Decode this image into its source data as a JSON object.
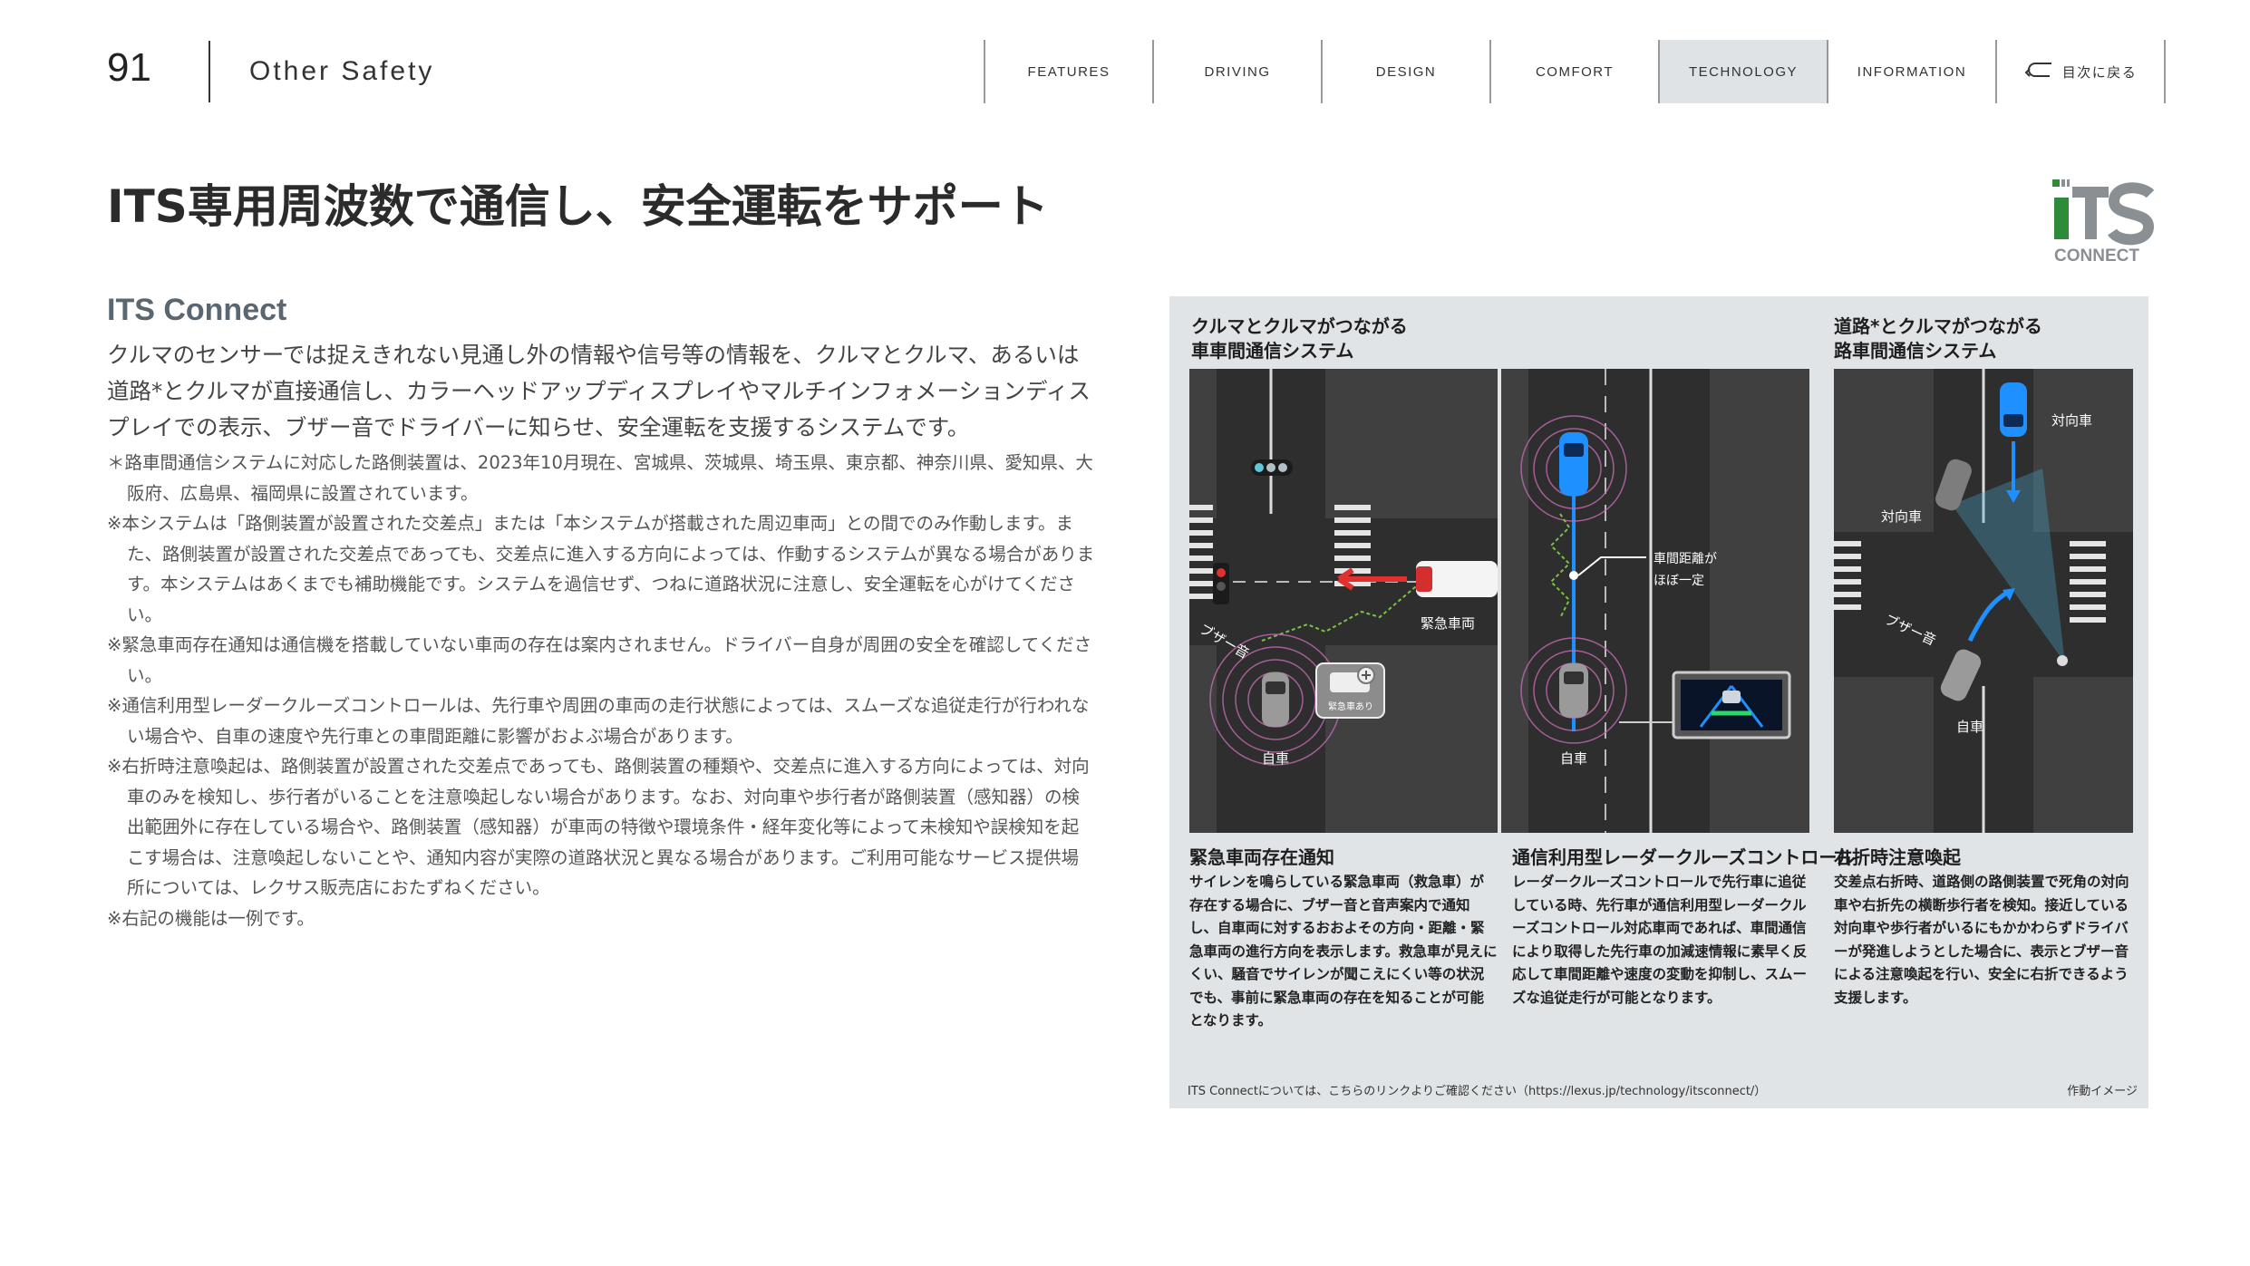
{
  "header": {
    "page_number": "91",
    "section_title": "Other Safety",
    "nav": [
      "FEATURES",
      "DRIVING",
      "DESIGN",
      "COMFORT",
      "TECHNOLOGY",
      "INFORMATION"
    ],
    "active_nav": "TECHNOLOGY",
    "back_label": "目次に戻る"
  },
  "main": {
    "heading": "ITS専用周波数で通信し、安全運転をサポート",
    "logo": {
      "text": "iTS",
      "sub": "CONNECT",
      "colors": {
        "green": "#2e8b3a",
        "gray": "#8a8f94"
      }
    }
  },
  "left": {
    "sub_heading": "ITS Connect",
    "intro": "クルマのセンサーでは捉えきれない見通し外の情報や信号等の情報を、クルマとクルマ、あるいは道路*とクルマが直接通信し、カラーヘッドアップディスプレイやマルチインフォメーションディスプレイでの表示、ブザー音でドライバーに知らせ、安全運転を支援するシステムです。",
    "notes": [
      "＊路車間通信システムに対応した路側装置は、2023年10月現在、宮城県、茨城県、埼玉県、東京都、神奈川県、愛知県、大阪府、広島県、福岡県に設置されています。",
      "※本システムは「路側装置が設置された交差点」または「本システムが搭載された周辺車両」との間でのみ作動します。また、路側装置が設置された交差点であっても、交差点に進入する方向によっては、作動するシステムが異なる場合があります。本システムはあくまでも補助機能です。システムを過信せず、つねに道路状況に注意し、安全運転を心がけてください。",
      "※緊急車両存在通知は通信機を搭載していない車両の存在は案内されません。ドライバー自身が周囲の安全を確認してください。",
      "※通信利用型レーダークルーズコントロールは、先行車や周囲の車両の走行状態によっては、スムーズな追従走行が行われない場合や、自車の速度や先行車との車間距離に影響がおよぶ場合があります。",
      "※右折時注意喚起は、路側装置が設置された交差点であっても、路側装置の種類や、交差点に進入する方向によっては、対向車のみを検知し、歩行者がいることを注意喚起しない場合があります。なお、対向車や歩行者が路側装置（感知器）の検出範囲外に存在している場合や、路側装置（感知器）が車両の特徴や環境条件・経年変化等によって未検知や誤検知を起こす場合は、注意喚起しないことや、通知内容が実際の道路状況と異なる場合があります。ご利用可能なサービス提供場所については、レクサス販売店におたずねください。",
      "※右記の機能は一例です。"
    ]
  },
  "panel": {
    "group1_title": "クルマとクルマがつながる\n車車間通信システム",
    "group2_title": "道路*とクルマがつながる\n路車間通信システム",
    "scenes": {
      "emergency": {
        "buzzer": "ブザー音",
        "ego": "自車",
        "emergency_vehicle": "緊急車両",
        "icon_label": "緊急車あり"
      },
      "cruise": {
        "gap_label_1": "車間距離が",
        "gap_label_2": "ほぼ一定",
        "ego": "自車"
      },
      "rightturn": {
        "oncoming_1": "対向車",
        "oncoming_2": "対向車",
        "buzzer": "ブザー音",
        "ego": "自車"
      }
    },
    "features": [
      {
        "title": "緊急車両存在通知",
        "body": "サイレンを鳴らしている緊急車両（救急車）が存在する場合に、ブザー音と音声案内で通知し、自車両に対するおおよその方向・距離・緊急車両の進行方向を表示します。救急車が見えにくい、騒音でサイレンが聞こえにくい等の状況でも、事前に緊急車両の存在を知ることが可能となります。"
      },
      {
        "title": "通信利用型レーダークルーズコントロール",
        "body": "レーダークルーズコントロールで先行車に追従している時、先行車が通信利用型レーダークルーズコントロール対応車両であれば、車間通信により取得した先行車の加減速情報に素早く反応して車間距離や速度の変動を抑制し、スムーズな追従走行が可能となります。"
      },
      {
        "title": "右折時注意喚起",
        "body": "交差点右折時、道路側の路側装置で死角の対向車や右折先の横断歩行者を検知。接近している対向車や歩行者がいるにもかかわらずドライバーが発進しようとした場合に、表示とブザー音による注意喚起を行い、安全に右折できるよう支援します。"
      }
    ],
    "footer_note": "ITS Connectについては、こちらのリンクよりご確認ください（https://lexus.jp/technology/itsconnect/）",
    "footer_image_note": "作動イメージ"
  },
  "colors": {
    "accent_blue": "#1e90ff",
    "alert_red": "#e03030",
    "signal_green": "#7cc242"
  }
}
